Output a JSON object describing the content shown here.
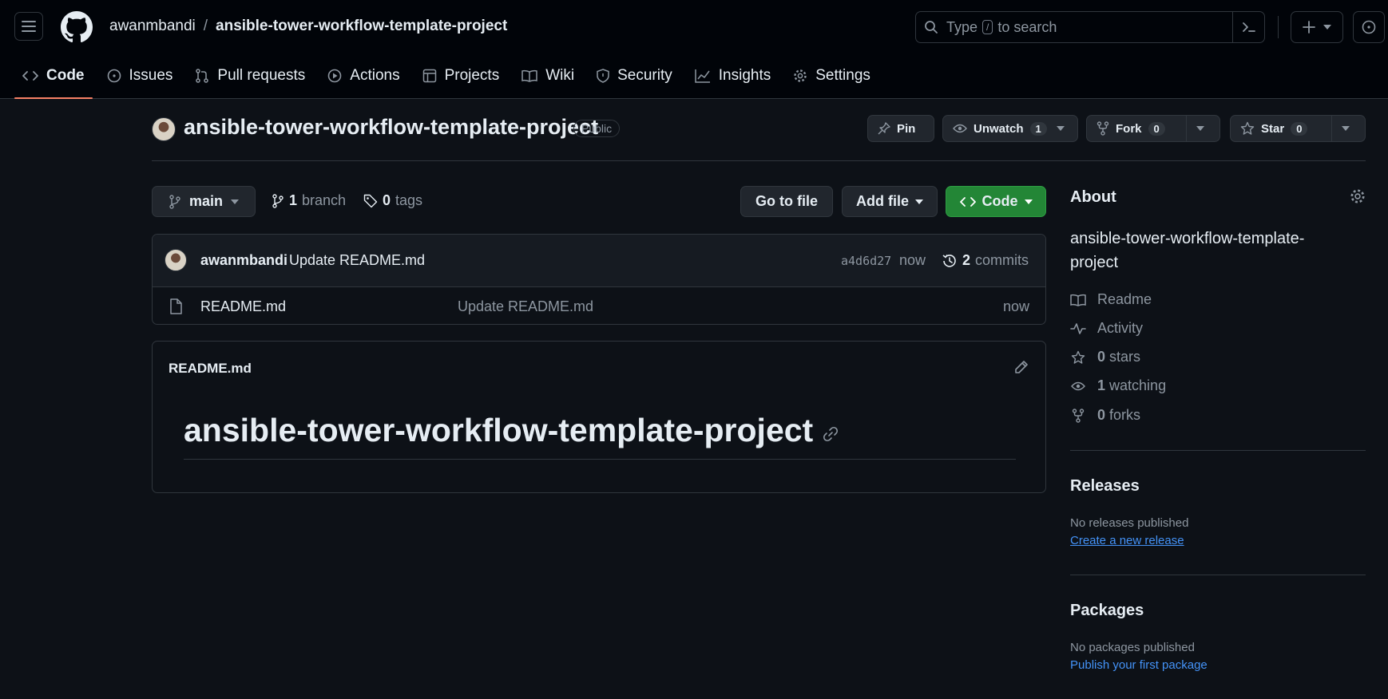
{
  "header": {
    "owner": "awanmbandi",
    "separator": "/",
    "repo": "ansible-tower-workflow-template-project",
    "search": {
      "prefix": "Type",
      "key": "/",
      "suffix": "to search"
    }
  },
  "nav": [
    {
      "label": "Code",
      "icon": "code-icon",
      "selected": true
    },
    {
      "label": "Issues",
      "icon": "issue-icon"
    },
    {
      "label": "Pull requests",
      "icon": "pull-request-icon"
    },
    {
      "label": "Actions",
      "icon": "play-icon"
    },
    {
      "label": "Projects",
      "icon": "table-icon"
    },
    {
      "label": "Wiki",
      "icon": "book-icon"
    },
    {
      "label": "Security",
      "icon": "shield-icon"
    },
    {
      "label": "Insights",
      "icon": "graph-icon"
    },
    {
      "label": "Settings",
      "icon": "gear-icon"
    }
  ],
  "repo": {
    "title": "ansible-tower-workflow-template-project",
    "visibility": "Public",
    "pin_label": "Pin",
    "watch_label": "Unwatch",
    "watch_count": "1",
    "fork_label": "Fork",
    "fork_count": "0",
    "star_label": "Star",
    "star_count": "0"
  },
  "toolbar": {
    "branch": "main",
    "branch_count": "1",
    "branch_label": "branch",
    "tag_count": "0",
    "tag_label": "tags",
    "go_to_file": "Go to file",
    "add_file": "Add file",
    "code": "Code"
  },
  "commit": {
    "author": "awanmbandi",
    "message": "Update README.md",
    "sha": "a4d6d27",
    "time": "now",
    "count": "2",
    "count_label": "commits"
  },
  "files": [
    {
      "name": "README.md",
      "message": "Update README.md",
      "time": "now"
    }
  ],
  "readme": {
    "filename": "README.md",
    "heading": "ansible-tower-workflow-template-project"
  },
  "about": {
    "title": "About",
    "description": "ansible-tower-workflow-template-project",
    "readme": "Readme",
    "activity": "Activity",
    "stars_count": "0",
    "stars_label": "stars",
    "watching_count": "1",
    "watching_label": "watching",
    "forks_count": "0",
    "forks_label": "forks"
  },
  "releases": {
    "title": "Releases",
    "empty": "No releases published",
    "link": "Create a new release"
  },
  "packages": {
    "title": "Packages",
    "empty": "No packages published",
    "link": "Publish your first package"
  },
  "colors": {
    "background": "#0d1117",
    "header_bg": "#010409",
    "border": "#30363d",
    "text": "#e6edf3",
    "muted": "#8d96a0",
    "accent_green": "#238636",
    "link": "#4493f8",
    "underline_nav": "#f78166"
  }
}
